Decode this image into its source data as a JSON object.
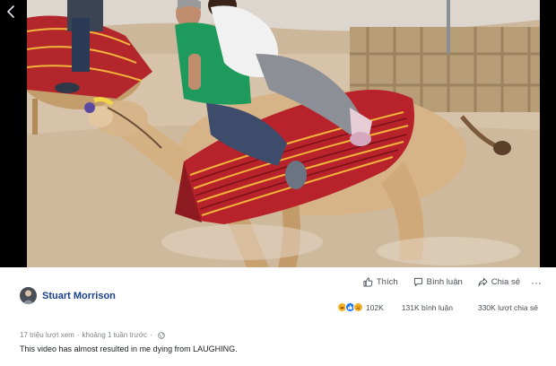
{
  "post": {
    "author": "Stuart Morrison",
    "views": "17 triệu lượt xem",
    "separator": "·",
    "time": "khoảng 1 tuần trước",
    "caption": "This video has almost resulted in me dying from LAUGHING."
  },
  "actions": {
    "like": "Thích",
    "comment": "Bình luận",
    "share": "Chia sẻ",
    "more": "···"
  },
  "stats": {
    "reactions_count": "102K",
    "comments": "131K bình luận",
    "shares": "330K lượt chia sẻ"
  },
  "icons": {
    "back": "chevron-left-icon",
    "like": "thumbs-up-icon",
    "comment": "comment-icon",
    "share": "share-icon",
    "privacy": "globe-icon"
  },
  "colors": {
    "author": "#1a3f8f",
    "text_secondary": "#7f8389",
    "reaction_haha": "#f7b125",
    "reaction_like": "#1877f2",
    "reaction_sad": "#f7b125"
  }
}
